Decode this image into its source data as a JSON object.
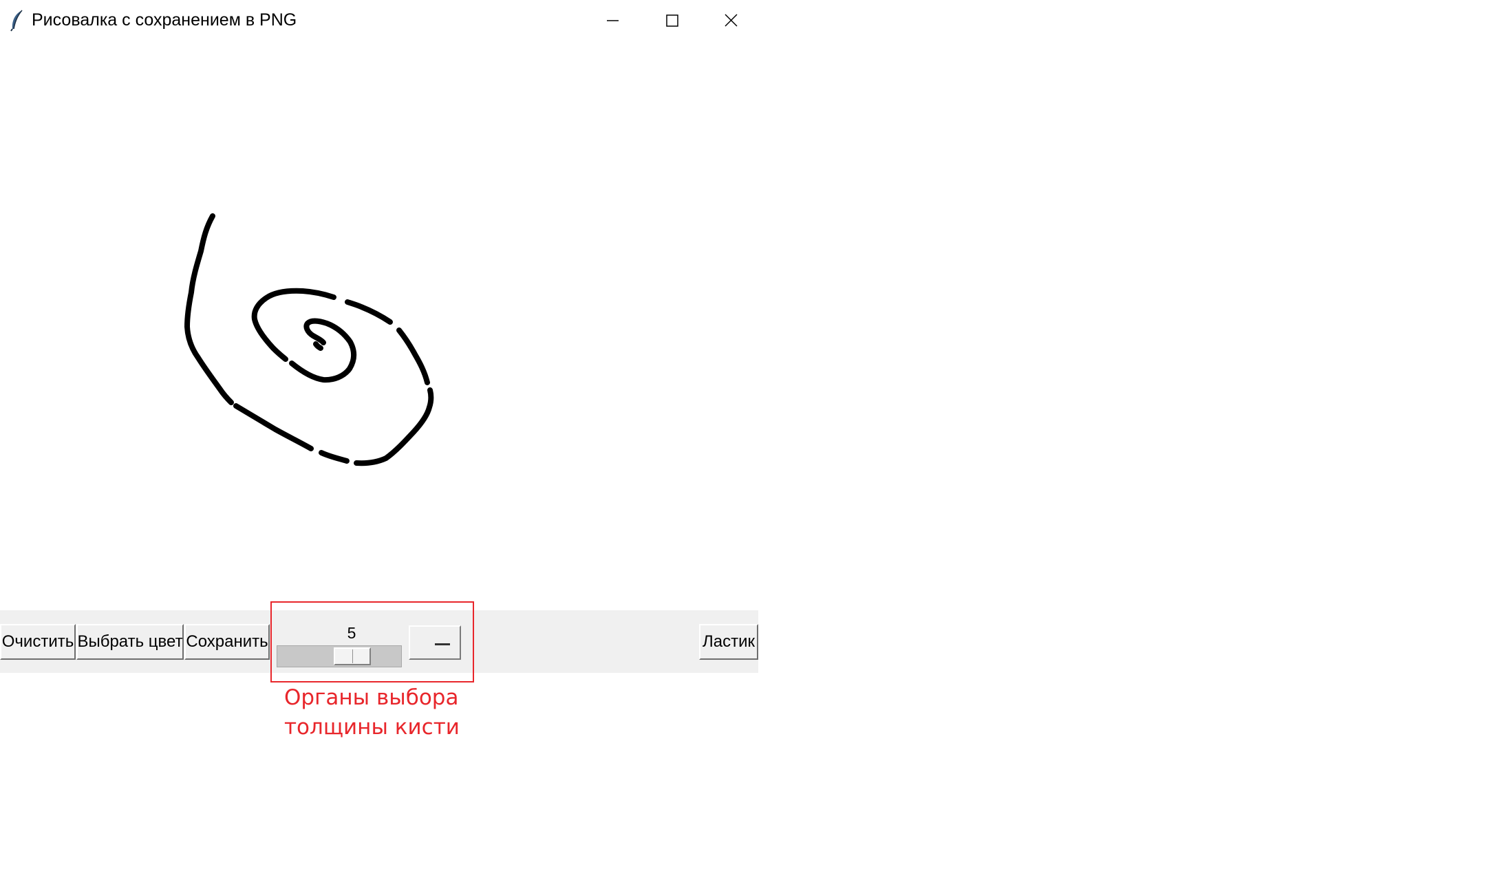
{
  "window": {
    "title": "Рисовалка с сохранением в PNG",
    "app_icon": "feather-icon",
    "controls": {
      "minimize_icon": "minimize-icon",
      "maximize_icon": "maximize-icon",
      "close_icon": "close-icon"
    }
  },
  "canvas": {
    "background": "#ffffff",
    "stroke_color": "#000000"
  },
  "toolbar": {
    "clear_label": "Очистить",
    "color_label": "Выбрать цвет",
    "save_label": "Сохранить",
    "eraser_label": "Ластик",
    "brush_size": {
      "value": "5",
      "min": 1,
      "max": 20
    }
  },
  "annotation": {
    "line1": "Органы выбора",
    "line2": "толщины кисти",
    "color": "#e8262b"
  }
}
